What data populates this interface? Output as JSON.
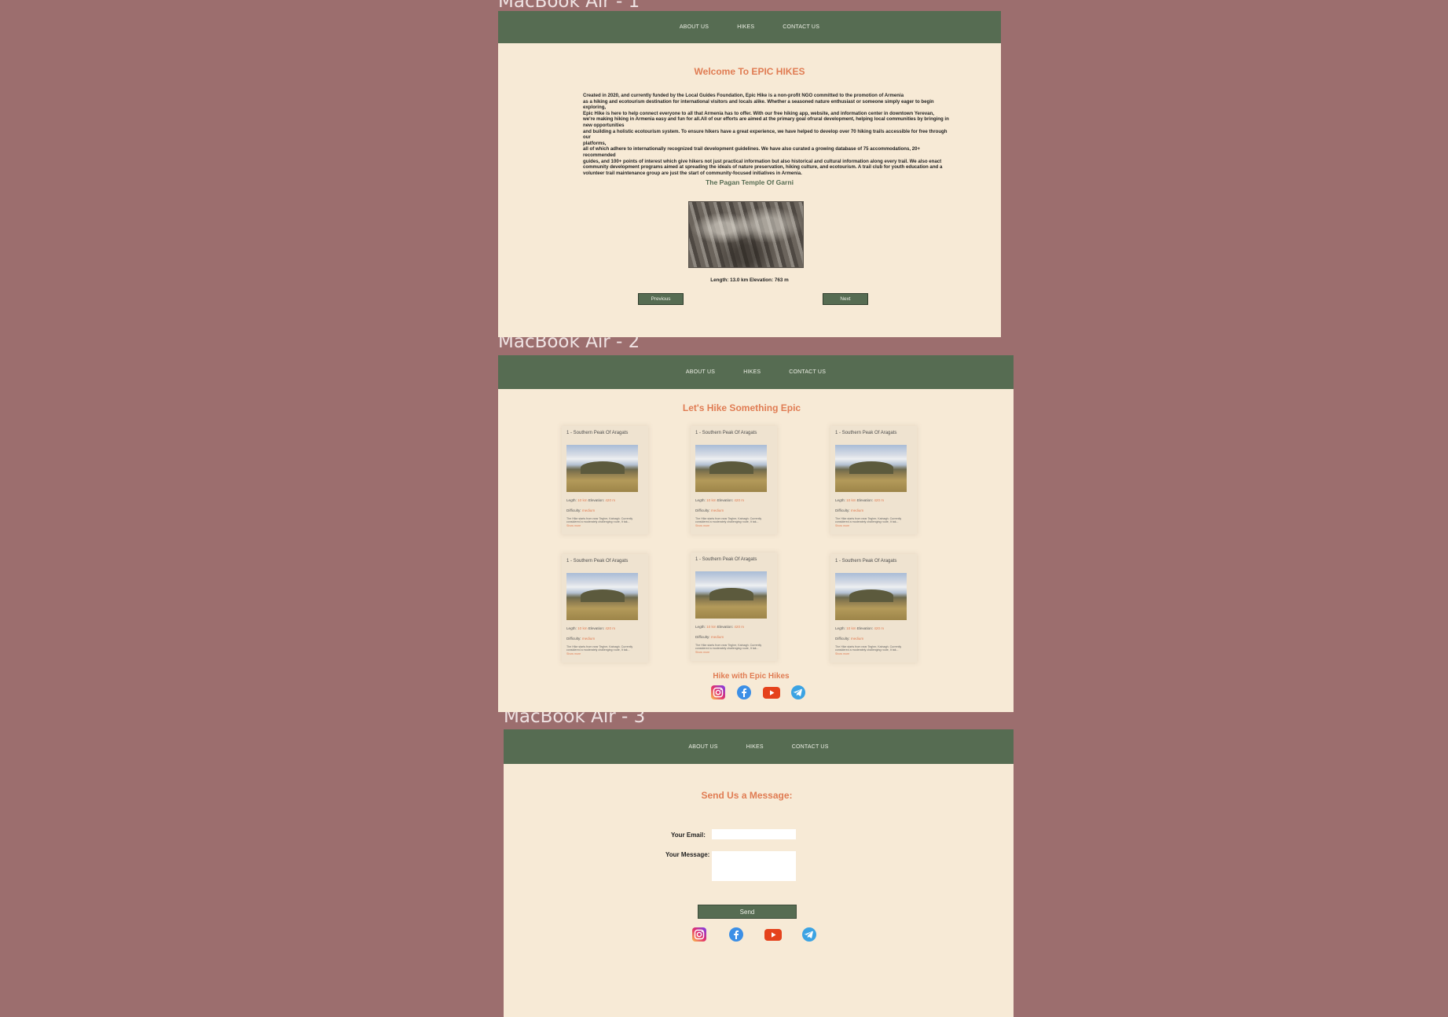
{
  "frames": [
    {
      "label": "MacBook Air - 1"
    },
    {
      "label": "MacBook Air - 2"
    },
    {
      "label": "MacBook Air - 3"
    }
  ],
  "nav": {
    "about": "ABOUT US",
    "hikes": "HIKES",
    "contact": "CONTACT US"
  },
  "page1": {
    "title": "Welcome To EPIC HIKES",
    "paragraph": [
      "Created in 2020, and currently funded by the Local Guides Foundation, Epic Hike is a non-profit NGO committed to the promotion of Armenia",
      "as a hiking and ecotourism destination for international visitors and locals alike. Whether a seasoned nature enthusiast or someone simply eager to begin exploring,",
      "Epic Hike is here to help connect everyone to all that Armenia has to offer. With our free hiking app, website, and information center in downtown Yerevan,",
      "we're making hiking in Armenia easy and fun for all.All of our efforts are aimed at the primary goal ofrural development, helping local communities by bringing in",
      "new opportunities",
      " and building a holistic ecotourism system. To ensure hikers have a great experience, we have helped to develop over 70 hiking trails accessible for free through our",
      "platforms,",
      " all of which adhere to internationally recognized trail development guidelines. We have also curated a growing database of 75 accommodations, 20+ recommended",
      "guides, and 100+ points of interest which give hikers not just practical information but also historical and cultural information along every trail. We also enact",
      "community development programs aimed at spreading the ideals of nature preservation, hiking culture, and ecotourism. A trail club for youth education and a",
      "volunteer trail maintenance group are just the start of community-focused initiatives in Armenia."
    ],
    "hike_title": "The Pagan Temple Of Garni",
    "caption": "Length: 13.0 km Elevation: 763 m",
    "prev": "Previous",
    "next": "Next"
  },
  "page2": {
    "title": "Let's Hike Something Epic",
    "cards": [
      {
        "title": "1 - Southern Peak Of Aragats",
        "length_label": "Legth:",
        "length": "10 km",
        "elev_label": "Elevation:",
        "elev": "420 m",
        "diff_label": "Difficulty:",
        "diff": "medium",
        "desc": "The Hike starts from near Tegher, Katnagh. Currently considered a moderately challenging route, It tak...",
        "more": "Show more"
      },
      {
        "title": "1 - Southern Peak Of Aragats",
        "length_label": "Legth:",
        "length": "10 km",
        "elev_label": "Elevation:",
        "elev": "420 m",
        "diff_label": "Difficulty:",
        "diff": "medium",
        "desc": "The Hike starts from near Tegher, Katnagh. Currently considered a moderately challenging route, It tak...",
        "more": "Show more"
      },
      {
        "title": "1 - Southern Peak Of Aragats",
        "length_label": "Legth:",
        "length": "10 km",
        "elev_label": "Elevation:",
        "elev": "420 m",
        "diff_label": "Difficulty:",
        "diff": "medium",
        "desc": "The Hike starts from near Tegher, Katnagh. Currently considered a moderately challenging route, It tak...",
        "more": "Show more"
      },
      {
        "title": "1 - Southern Peak Of Aragats",
        "length_label": "Legth:",
        "length": "10 km",
        "elev_label": "Elevation:",
        "elev": "420 m",
        "diff_label": "Difficulty:",
        "diff": "medium",
        "desc": "The Hike starts from near Tegher, Katnagh. Currently considered a moderately challenging route, It tak...",
        "more": "Show more"
      },
      {
        "title": "1 - Southern Peak Of Aragats",
        "length_label": "Legth:",
        "length": "10 km",
        "elev_label": "Elevation:",
        "elev": "420 m",
        "diff_label": "Difficulty:",
        "diff": "medium",
        "desc": "The Hike starts from near Tegher, Katnagh. Currently considered a moderately challenging route, It tak...",
        "more": "Show more"
      },
      {
        "title": "1 - Southern Peak Of Aragats",
        "length_label": "Legth:",
        "length": "10 km",
        "elev_label": "Elevation:",
        "elev": "420 m",
        "diff_label": "Difficulty:",
        "diff": "medium",
        "desc": "The Hike starts from near Tegher, Katnagh. Currently considered a moderately challenging route, It tak...",
        "more": "Show more"
      }
    ],
    "footer_title": "Hike with Epic Hikes"
  },
  "page3": {
    "title": "Send Us a Message:",
    "email_label": "Your Email:",
    "email_value": "",
    "message_label": "Your Message:",
    "message_value": "",
    "send": "Send"
  },
  "social_icons": [
    "instagram-icon",
    "facebook-icon",
    "youtube-icon",
    "telegram-icon"
  ],
  "colors": {
    "background": "#9c6e6e",
    "page": "#f7ead6",
    "nav": "#566c52",
    "accent": "#e07c53",
    "green_text": "#566c52"
  }
}
